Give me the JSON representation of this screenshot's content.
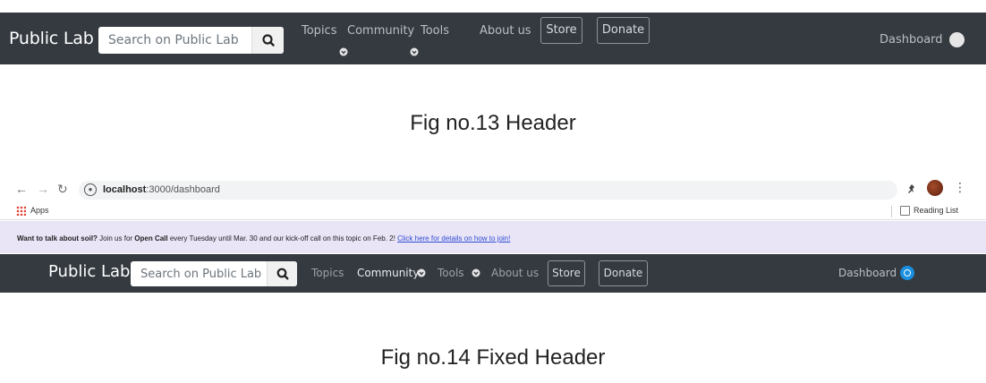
{
  "fig13": {
    "header": {
      "brand": "Public Lab",
      "search_placeholder": "Search on Public Lab",
      "nav": {
        "topics": "Topics",
        "community": "Community",
        "tools": "Tools",
        "about": "About us",
        "store": "Store",
        "donate": "Donate",
        "dashboard": "Dashboard"
      }
    },
    "caption": "Fig no.13 Header"
  },
  "fig14": {
    "browser": {
      "url_host": "localhost",
      "url_path": ":3000/dashboard",
      "bookmarks_apps": "Apps",
      "reading_list": "Reading List"
    },
    "banner": {
      "part1_bold": "Want to talk about soil?",
      "part2": " Join us for ",
      "part3_bold": "Open Call",
      "part4": " every Tuesday until Mar. 30 and our kick-off call on this topic on Feb. 2! ",
      "link": "Click here for details on how to join!"
    },
    "header": {
      "brand": "Public Lab",
      "search_placeholder": "Search on Public Lab",
      "nav": {
        "topics": "Topics",
        "community": "Community",
        "tools": "Tools",
        "about": "About us",
        "store": "Store",
        "donate": "Donate",
        "dashboard": "Dashboard"
      }
    },
    "caption": "Fig no.14 Fixed Header"
  },
  "colors": {
    "navbar_bg": "#343a40",
    "banner_bg": "#e9e5f7",
    "link_blue": "#2f4bd1",
    "avatar_blue": "#1a8fe0"
  }
}
